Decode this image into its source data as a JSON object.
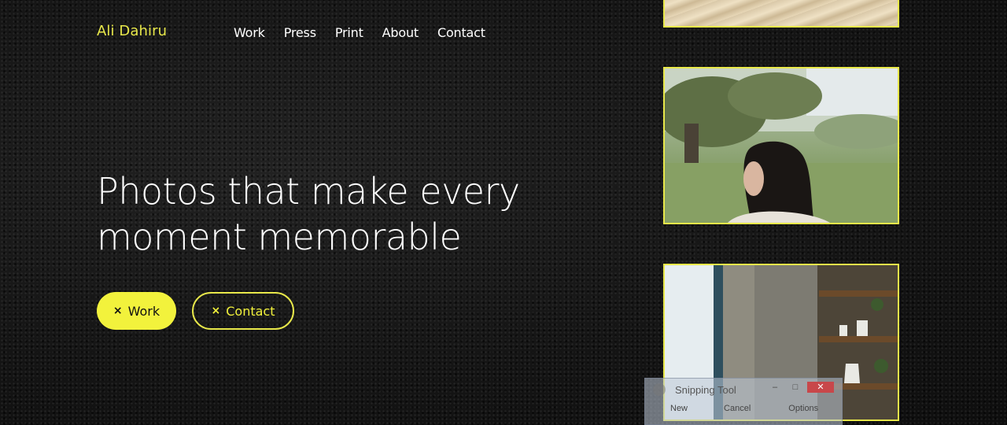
{
  "brand": "Ali Dahiru",
  "nav": {
    "items": [
      "Work",
      "Press",
      "Print",
      "About",
      "Contact"
    ]
  },
  "hero": {
    "line1": "Photos that make every",
    "line2": "moment memorable",
    "buttons": {
      "work": "Work",
      "contact": "Contact",
      "icon": "×"
    }
  },
  "gallery": {
    "photos": [
      "sand-photo",
      "portrait-in-field-photo",
      "window-shelf-photo"
    ]
  },
  "snipping_tool": {
    "title": "Snipping Tool",
    "minimize": "–",
    "maximize": "□",
    "close": "✕",
    "new_label": "New",
    "cancel_label": "Cancel",
    "options_label": "Options"
  },
  "colors": {
    "accent": "#f2f23c",
    "background": "#151515",
    "text": "#ffffff"
  }
}
